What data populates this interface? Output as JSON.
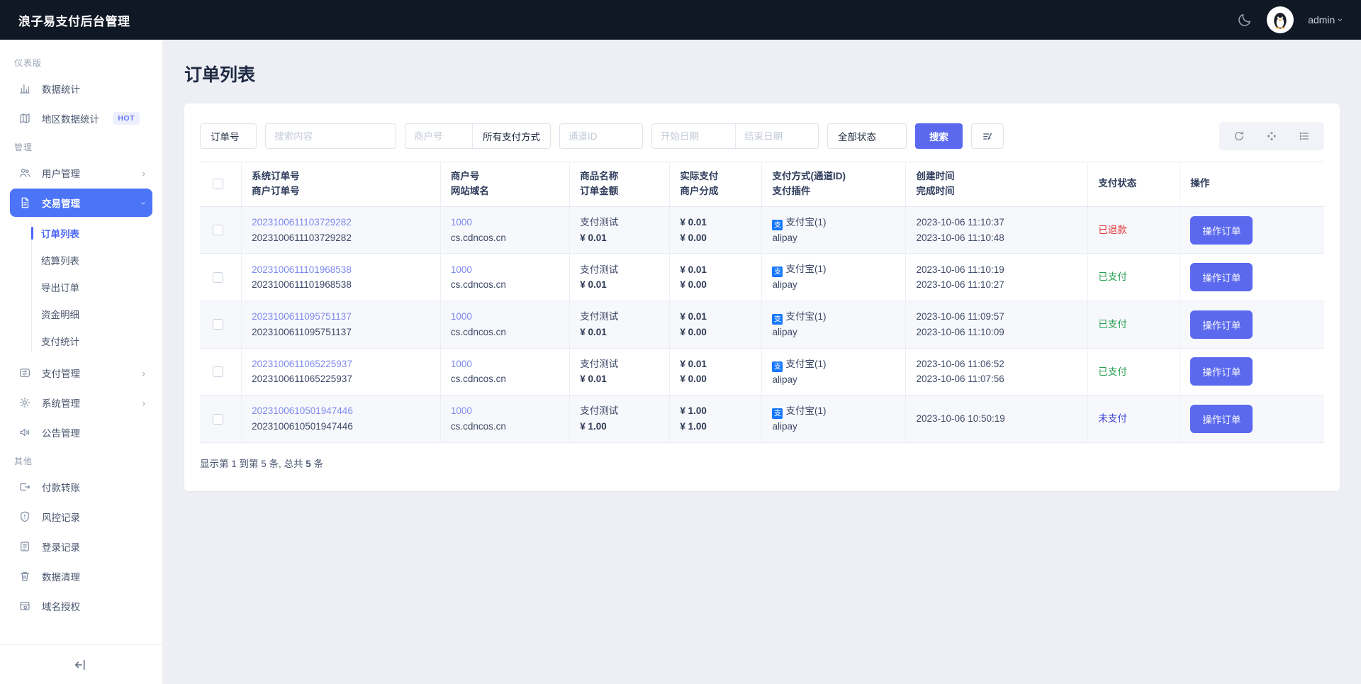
{
  "header": {
    "title": "浪子易支付后台管理",
    "user": "admin"
  },
  "sidebar": {
    "sections": [
      {
        "label": "仪表版",
        "items": [
          {
            "label": "数据统计",
            "icon": "chart"
          },
          {
            "label": "地区数据统计",
            "icon": "map",
            "badge": "HOT"
          }
        ]
      },
      {
        "label": "管理",
        "items": [
          {
            "label": "用户管理",
            "icon": "users",
            "chevron": "right"
          },
          {
            "label": "交易管理",
            "icon": "file",
            "chevron": "down",
            "active": true,
            "children": [
              "订单列表",
              "结算列表",
              "导出订单",
              "资金明细",
              "支付统计"
            ],
            "active_child": "订单列表"
          },
          {
            "label": "支付管理",
            "icon": "transfer",
            "chevron": "right"
          },
          {
            "label": "系统管理",
            "icon": "gear",
            "chevron": "right"
          },
          {
            "label": "公告管理",
            "icon": "speaker"
          }
        ]
      },
      {
        "label": "其他",
        "items": [
          {
            "label": "付款转账",
            "icon": "send"
          },
          {
            "label": "风控记录",
            "icon": "shield"
          },
          {
            "label": "登录记录",
            "icon": "doc"
          },
          {
            "label": "数据清理",
            "icon": "trash"
          },
          {
            "label": "域名授权",
            "icon": "browser"
          }
        ]
      }
    ]
  },
  "page": {
    "title": "订单列表"
  },
  "filters": {
    "order_type": "订单号",
    "search_placeholder": "搜索内容",
    "merchant_placeholder": "商户号",
    "pay_method": "所有支付方式",
    "channel_placeholder": "通道ID",
    "start_placeholder": "开始日期",
    "end_placeholder": "结束日期",
    "status": "全部状态",
    "search_button": "搜索"
  },
  "table": {
    "headers": [
      {
        "l1": "系统订单号",
        "l2": "商户订单号"
      },
      {
        "l1": "商户号",
        "l2": "网站域名"
      },
      {
        "l1": "商品名称",
        "l2": "订单金额"
      },
      {
        "l1": "实际支付",
        "l2": "商户分成"
      },
      {
        "l1": "支付方式(通道ID)",
        "l2": "支付插件"
      },
      {
        "l1": "创建时间",
        "l2": "完成时间"
      },
      {
        "l1": "支付状态",
        "l2": ""
      },
      {
        "l1": "操作",
        "l2": ""
      }
    ],
    "rows": [
      {
        "system_order": "2023100611103729282",
        "merchant_order": "2023100611103729282",
        "merchant_id": "1000",
        "domain": "cs.cdncos.cn",
        "product": "支付测试",
        "amount": "¥ 0.01",
        "paid": "¥ 0.01",
        "share": "¥ 0.00",
        "method": "支付宝(1)",
        "plugin": "alipay",
        "created": "2023-10-06 11:10:37",
        "completed": "2023-10-06 11:10:48",
        "status": "已退款",
        "status_color": "#e03a3c",
        "action": "操作订单"
      },
      {
        "system_order": "2023100611101968538",
        "merchant_order": "2023100611101968538",
        "merchant_id": "1000",
        "domain": "cs.cdncos.cn",
        "product": "支付测试",
        "amount": "¥ 0.01",
        "paid": "¥ 0.01",
        "share": "¥ 0.00",
        "method": "支付宝(1)",
        "plugin": "alipay",
        "created": "2023-10-06 11:10:19",
        "completed": "2023-10-06 11:10:27",
        "status": "已支付",
        "status_color": "#28a153",
        "action": "操作订单"
      },
      {
        "system_order": "2023100611095751137",
        "merchant_order": "2023100611095751137",
        "merchant_id": "1000",
        "domain": "cs.cdncos.cn",
        "product": "支付测试",
        "amount": "¥ 0.01",
        "paid": "¥ 0.01",
        "share": "¥ 0.00",
        "method": "支付宝(1)",
        "plugin": "alipay",
        "created": "2023-10-06 11:09:57",
        "completed": "2023-10-06 11:10:09",
        "status": "已支付",
        "status_color": "#28a153",
        "action": "操作订单"
      },
      {
        "system_order": "2023100611065225937",
        "merchant_order": "2023100611065225937",
        "merchant_id": "1000",
        "domain": "cs.cdncos.cn",
        "product": "支付测试",
        "amount": "¥ 0.01",
        "paid": "¥ 0.01",
        "share": "¥ 0.00",
        "method": "支付宝(1)",
        "plugin": "alipay",
        "created": "2023-10-06 11:06:52",
        "completed": "2023-10-06 11:07:56",
        "status": "已支付",
        "status_color": "#28a153",
        "action": "操作订单"
      },
      {
        "system_order": "2023100610501947446",
        "merchant_order": "2023100610501947446",
        "merchant_id": "1000",
        "domain": "cs.cdncos.cn",
        "product": "支付测试",
        "amount": "¥ 1.00",
        "paid": "¥ 1.00",
        "share": "¥ 1.00",
        "method": "支付宝(1)",
        "plugin": "alipay",
        "created": "2023-10-06 10:50:19",
        "completed": "",
        "status": "未支付",
        "status_color": "#3b43d8",
        "action": "操作订单"
      }
    ],
    "alipay_glyph": "支"
  },
  "pagination": {
    "prefix": "显示第 1 到第 5 条, 总共",
    "total": "5",
    "suffix": "条"
  },
  "colors": {
    "topbar_bg": "#101725",
    "sidebar_active": "#4b74f6",
    "accent_button": "#5a69ee",
    "link": "#7c89ee",
    "status_refunded": "#e03a3c",
    "status_paid": "#28a153",
    "status_unpaid": "#3b43d8",
    "alipay_blue": "#1677ff",
    "main_bg": "#edeff4"
  }
}
